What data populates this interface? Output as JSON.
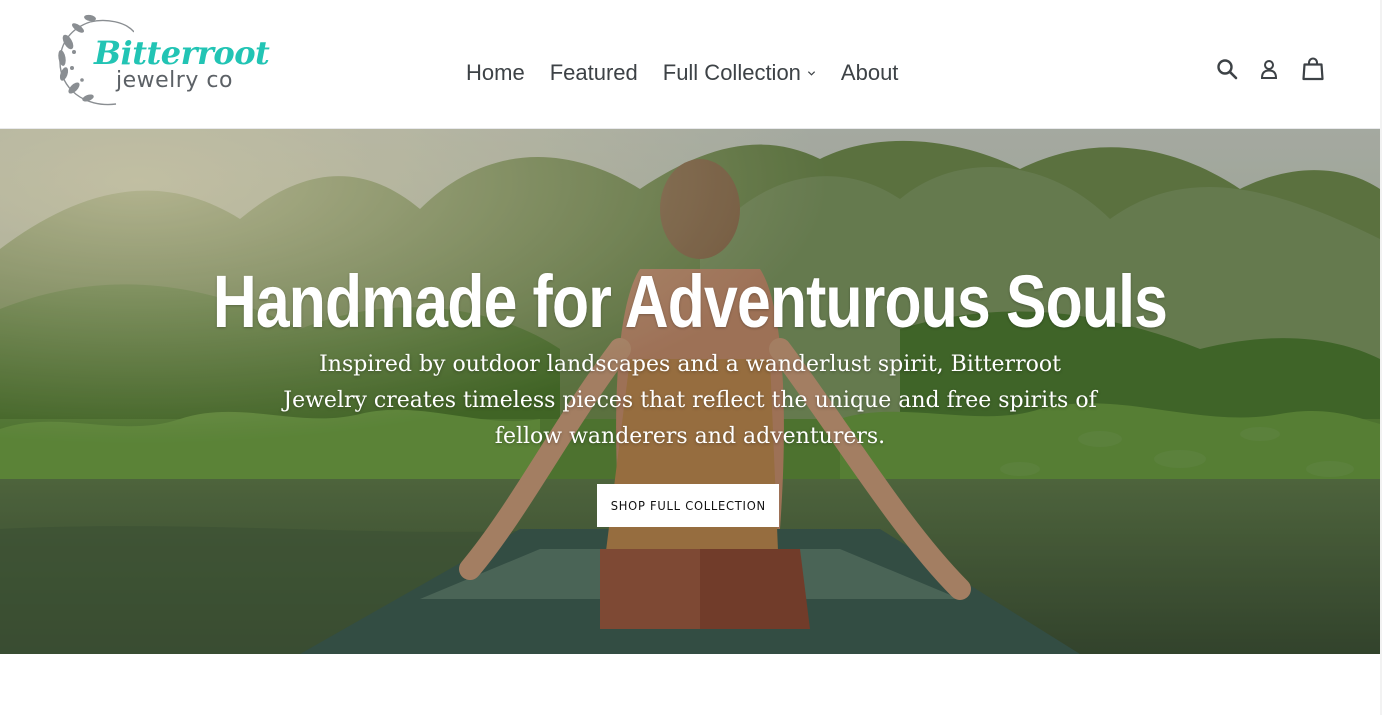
{
  "header": {
    "logo": {
      "script_text": "Bitterroot",
      "sub_text": "jewelry co",
      "accent_color": "#22c4b4"
    },
    "nav": [
      {
        "label": "Home"
      },
      {
        "label": "Featured"
      },
      {
        "label": "Full Collection",
        "has_dropdown": true
      },
      {
        "label": "About"
      }
    ],
    "icons": [
      "search-icon",
      "account-icon",
      "cart-icon"
    ]
  },
  "hero": {
    "title": "Handmade for Adventurous Souls",
    "text": "Inspired by outdoor landscapes and a wanderlust spirit, Bitterroot Jewelry creates timeless pieces that reflect the unique and free spirits of fellow wanderers and adventurers.",
    "button_label": "SHOP FULL COLLECTION"
  }
}
